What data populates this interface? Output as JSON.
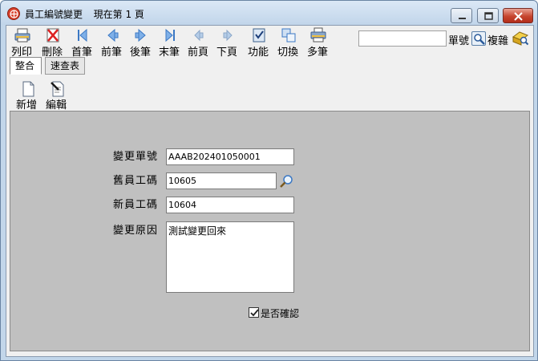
{
  "window": {
    "title": "員工編號變更",
    "status": "現在第 1 頁"
  },
  "toolbar": {
    "items": [
      {
        "label": "列印",
        "icon": "printer-icon"
      },
      {
        "label": "刪除",
        "icon": "delete-icon"
      },
      {
        "label": "首筆",
        "icon": "first-record-icon"
      },
      {
        "label": "前筆",
        "icon": "previous-record-icon"
      },
      {
        "label": "後筆",
        "icon": "next-record-icon"
      },
      {
        "label": "末筆",
        "icon": "last-record-icon"
      },
      {
        "label": "前頁",
        "icon": "previous-page-icon"
      },
      {
        "label": "下頁",
        "icon": "next-page-icon"
      },
      {
        "label": "功能",
        "icon": "function-icon"
      },
      {
        "label": "切換",
        "icon": "switch-icon"
      },
      {
        "label": "多筆",
        "icon": "multi-record-icon"
      }
    ],
    "search_value": "",
    "search_type_label": "單號",
    "complex_label": "複雜"
  },
  "tabs": [
    {
      "label": "整合",
      "active": true
    },
    {
      "label": "速查表",
      "active": false
    }
  ],
  "subtoolbar": {
    "add_label": "新增",
    "edit_label": "編輯"
  },
  "form": {
    "change_no_label": "變更單號",
    "change_no_value": "AAAB202401050001",
    "old_emp_label": "舊員工碼",
    "old_emp_value": "10605",
    "new_emp_label": "新員工碼",
    "new_emp_value": "10604",
    "reason_label": "變更原因",
    "reason_value": "測試變更回來",
    "confirm_label": "是否確認",
    "confirm_checked": true
  },
  "colors": {
    "window_frame": "#c2d6ea",
    "close_button": "#c6452f",
    "panel_background": "#c0c0c0",
    "nav_blue": "#3b78c4"
  }
}
